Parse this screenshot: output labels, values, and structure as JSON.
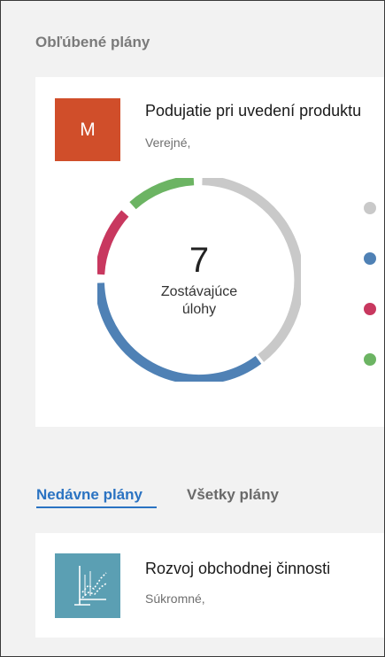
{
  "favorites": {
    "section_title": "Obľúbené plány",
    "plan": {
      "tile_letter": "M",
      "tile_color": "#d04e2a",
      "name": "Podujatie pri uvedení produktu",
      "visibility": "Verejné,"
    },
    "chart": {
      "remaining_count": "7",
      "remaining_label": "Zostávajúce úlohy",
      "segments": [
        {
          "color": "#c9c9c9",
          "status": "gray"
        },
        {
          "color": "#4f81b5",
          "status": "blue"
        },
        {
          "color": "#c8385f",
          "status": "red"
        },
        {
          "color": "#6cb463",
          "status": "green"
        }
      ]
    }
  },
  "tabs": {
    "recent_label": "Nedávne plány",
    "all_label": "Všetky plány",
    "active_color": "#2b73c2"
  },
  "recent": {
    "plan": {
      "tile_icon": "chart-icon",
      "tile_color": "#5b9fb3",
      "name": "Rozvoj obchodnej činnosti",
      "visibility": "Súkromné,"
    }
  }
}
